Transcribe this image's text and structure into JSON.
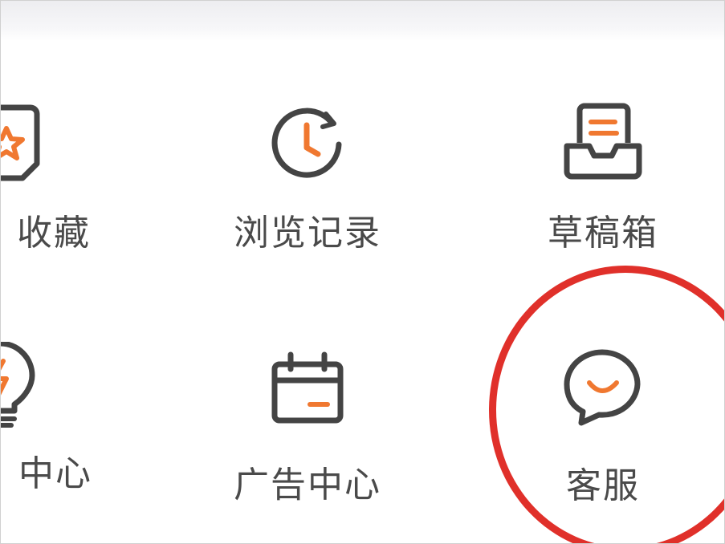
{
  "menu": {
    "row1": [
      {
        "label": "收藏",
        "icon": "star-bookmark-icon"
      },
      {
        "label": "浏览记录",
        "icon": "history-clock-icon"
      },
      {
        "label": "草稿箱",
        "icon": "draft-tray-icon"
      }
    ],
    "row2": [
      {
        "label": "中心",
        "icon": "lightbulb-icon"
      },
      {
        "label": "广告中心",
        "icon": "calendar-icon"
      },
      {
        "label": "客服",
        "icon": "chat-bubble-icon"
      }
    ]
  },
  "colors": {
    "icon_stroke": "#444444",
    "accent": "#f07830",
    "highlight_circle": "#e0302a",
    "label_text": "#4a4a4a"
  }
}
